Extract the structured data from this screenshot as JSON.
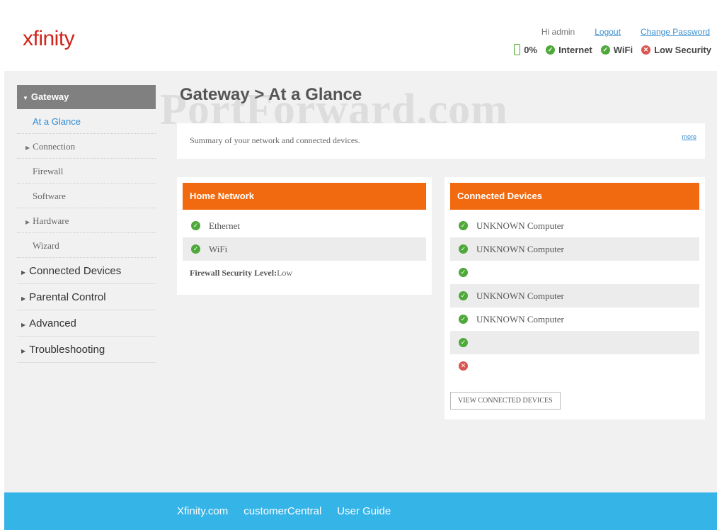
{
  "header": {
    "logo": "xfinity",
    "greeting": "Hi admin",
    "logout": "Logout",
    "change_password": "Change Password",
    "status": {
      "battery": "0%",
      "internet": "Internet",
      "wifi": "WiFi",
      "security": "Low Security"
    }
  },
  "sidebar": {
    "gateway": "Gateway",
    "sub_items": [
      "At a Glance",
      "Connection",
      "Firewall",
      "Software",
      "Hardware",
      "Wizard"
    ],
    "main_items": [
      "Connected Devices",
      "Parental Control",
      "Advanced",
      "Troubleshooting"
    ]
  },
  "page": {
    "title": "Gateway > At a Glance",
    "watermark": "PortForward.com",
    "summary": "Summary of your network and connected devices.",
    "more": "more"
  },
  "home_network": {
    "title": "Home Network",
    "items": [
      "Ethernet",
      "WiFi"
    ],
    "firewall_label": "Firewall Security Level:",
    "firewall_value": "Low"
  },
  "connected_devices": {
    "title": "Connected Devices",
    "devices": [
      "UNKNOWN Computer",
      "UNKNOWN Computer",
      "",
      "UNKNOWN Computer",
      "UNKNOWN Computer",
      "",
      ""
    ],
    "button": "VIEW CONNECTED DEVICES"
  },
  "footer": {
    "links": [
      "Xfinity.com",
      "customerCentral",
      "User Guide"
    ]
  },
  "colors": {
    "accent_orange": "#f26a10",
    "footer_blue": "#35b4e8",
    "status_green": "#4ea83a",
    "status_red": "#d9534f",
    "logo_red": "#d0261d"
  }
}
